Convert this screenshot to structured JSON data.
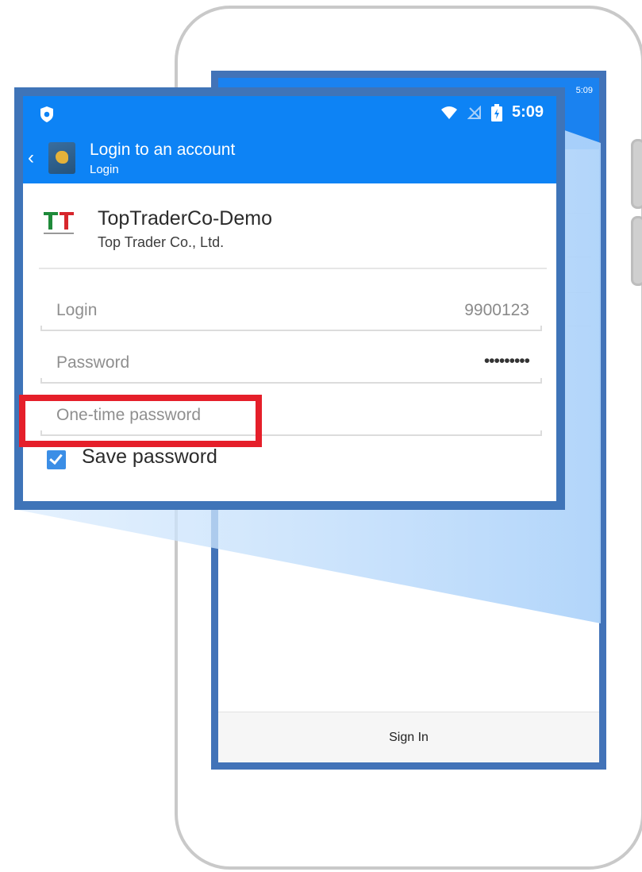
{
  "status_bar": {
    "time": "5:09"
  },
  "app_bar": {
    "title": "Login to an account",
    "subtitle": "Login"
  },
  "broker": {
    "name": "TopTraderCo-Demo",
    "company": "Top Trader Co., Ltd."
  },
  "form": {
    "login_label": "Login",
    "login_value": "9900123",
    "password_label": "Password",
    "password_value": "•••••••••",
    "otp_label": "One-time password",
    "save_password_label": "Save password",
    "save_password_checked": true
  },
  "phone": {
    "status_time": "5:09",
    "sign_in_label": "Sign In"
  },
  "colors": {
    "app_bar": "#0d83f5",
    "frame_border": "#3f74b8",
    "highlight": "#e51f2a",
    "checkbox": "#3b8ee6"
  }
}
